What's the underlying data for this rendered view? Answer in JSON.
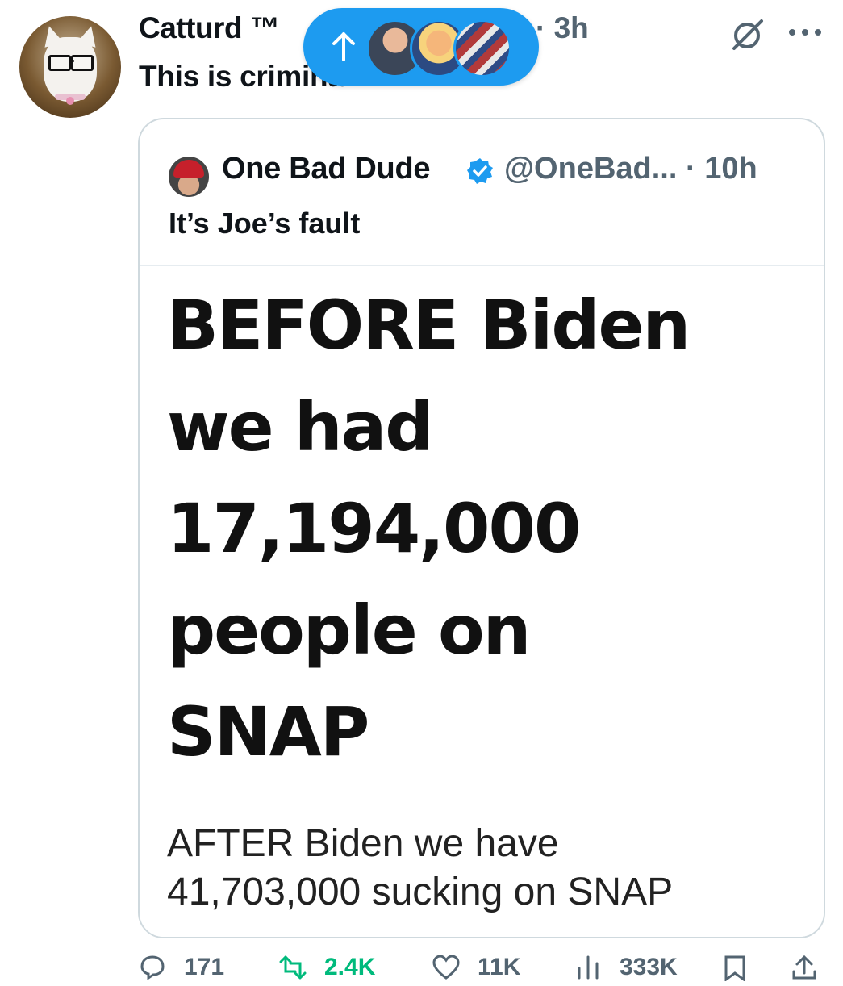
{
  "post": {
    "author_name": "Catturd ™",
    "time": "· 3h",
    "text": "This is criminal."
  },
  "new_posts_pill": {
    "arrow": "↑"
  },
  "quote": {
    "author_name": "One Bad Dude",
    "handle_time": "@OneBad... · 10h",
    "text": "It’s Joe’s fault",
    "image_text": {
      "headline": "BEFORE Biden\nwe had\n17,194,000\npeople on\nSNAP",
      "caption": "AFTER Biden we have\n41,703,000 sucking on SNAP"
    }
  },
  "actions": {
    "replies": "171",
    "reposts": "2.4K",
    "likes": "11K",
    "views": "333K"
  },
  "colors": {
    "accent": "#1d9bf0",
    "muted": "#536471",
    "repost_green": "#00ba7c"
  }
}
